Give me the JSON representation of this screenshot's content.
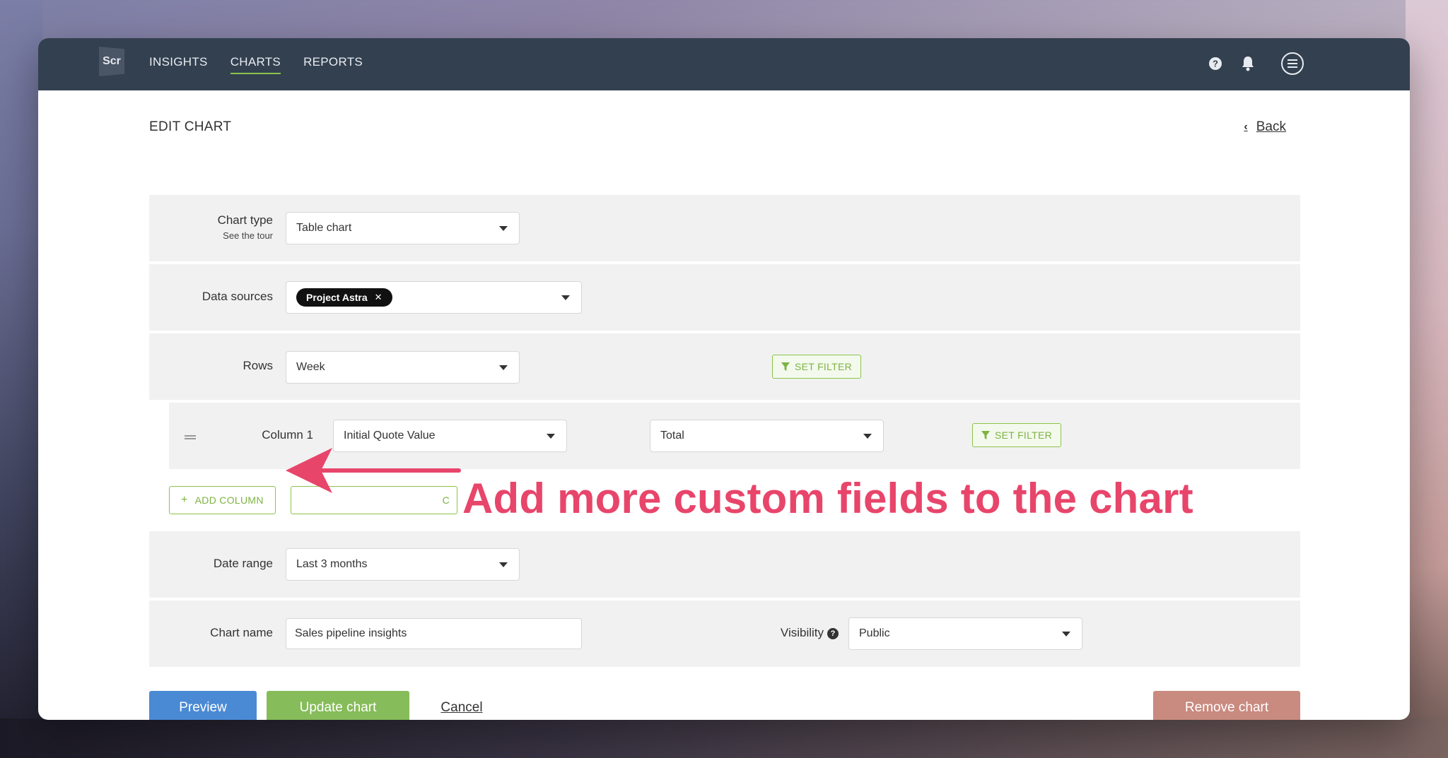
{
  "nav": {
    "logo_text": "Scr",
    "items": [
      {
        "label": "INSIGHTS",
        "active": false
      },
      {
        "label": "CHARTS",
        "active": true
      },
      {
        "label": "REPORTS",
        "active": false
      }
    ],
    "icons": [
      "help-icon",
      "bell-icon",
      "menu-icon"
    ]
  },
  "page": {
    "title": "EDIT CHART",
    "back_label": "Back"
  },
  "form": {
    "chart_type": {
      "label": "Chart type",
      "sublabel": "See the tour",
      "value": "Table chart"
    },
    "data_sources": {
      "label": "Data sources",
      "tag": "Project Astra"
    },
    "rows": {
      "label": "Rows",
      "value": "Week",
      "filter_label": "SET FILTER"
    },
    "column1": {
      "label": "Column 1",
      "field": "Initial Quote Value",
      "aggregate": "Total",
      "filter_label": "SET FILTER"
    },
    "add_column_label": "ADD COLUMN",
    "hidden_button_fragment": "C",
    "date_range": {
      "label": "Date range",
      "value": "Last 3 months"
    },
    "chart_name": {
      "label": "Chart name",
      "value": "Sales pipeline insights"
    },
    "visibility": {
      "label": "Visibility",
      "value": "Public"
    }
  },
  "actions": {
    "preview": "Preview",
    "update": "Update chart",
    "cancel": "Cancel",
    "remove": "Remove chart"
  },
  "annotation": {
    "text": "Add more custom fields to the chart",
    "color": "#e8456b"
  },
  "colors": {
    "topbar": "#334050",
    "accent_green": "#8bc34a",
    "preview_blue": "#4a8ad4",
    "update_green": "#86bc5a",
    "remove_red": "#c98a7f"
  }
}
